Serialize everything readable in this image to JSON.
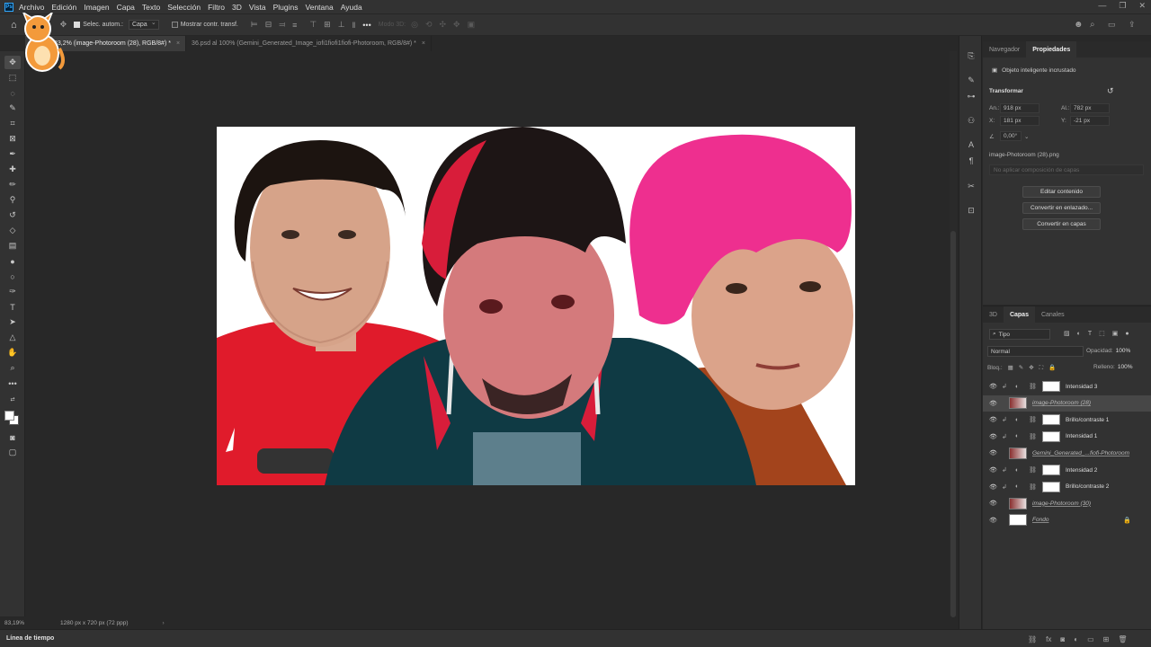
{
  "menubar": {
    "logo": "Ps",
    "items": [
      "Archivo",
      "Edición",
      "Imagen",
      "Capa",
      "Texto",
      "Selección",
      "Filtro",
      "3D",
      "Vista",
      "Plugins",
      "Ventana",
      "Ayuda"
    ]
  },
  "options": {
    "auto_select_label": "Selec. autom.:",
    "auto_select_target": "Capa",
    "show_transform_label": "Mostrar contr. transf.",
    "mode_3d_label": "Modo 3D:"
  },
  "tabs": [
    {
      "label": "83,2% (image-Photoroom (28), RGB/8#) *",
      "active": true
    },
    {
      "label": "36.psd al 100% (Gemini_Generated_Image_iofi1fiofi1fiofi-Photoroom, RGB/8#) *",
      "active": false
    }
  ],
  "status": {
    "zoom": "83,19%",
    "doc_info": "1280 px x 720 px (72 ppp)"
  },
  "timeline": {
    "label": "Línea de tiempo"
  },
  "properties": {
    "tabs": [
      "Navegador",
      "Propiedades"
    ],
    "active_tab": "Propiedades",
    "layer_type": "Objeto inteligente incrustado",
    "transform_title": "Transformar",
    "width_label": "An.:",
    "width_value": "918 px",
    "height_label": "Al.:",
    "height_value": "782 px",
    "x_label": "X:",
    "x_value": "181 px",
    "y_label": "Y:",
    "y_value": "-21 px",
    "angle_value": "0,00°",
    "source_file": "image-Photoroom (28).png",
    "comp_placeholder": "No aplicar composición de capas",
    "buttons": [
      "Editar contenido",
      "Convertir en enlazado...",
      "Convertir en capas"
    ]
  },
  "layers_panel": {
    "tabs": [
      "3D",
      "Capas",
      "Canales"
    ],
    "active_tab": "Capas",
    "filter_kind": "Tipo",
    "blend_mode": "Normal",
    "opacity_label": "Opacidad:",
    "opacity_value": "100%",
    "lock_label": "Bloq.:",
    "fill_label": "Relleno:",
    "fill_value": "100%",
    "layers": [
      {
        "name": "Intensidad 3",
        "kind": "adjustment",
        "selected": false
      },
      {
        "name": "image-Photoroom (28)",
        "kind": "smart",
        "selected": true
      },
      {
        "name": "Brillo/contraste 1",
        "kind": "adjustment",
        "selected": false
      },
      {
        "name": "Intensidad 1",
        "kind": "adjustment",
        "selected": false
      },
      {
        "name": "Gemini_Generated_...fiofi-Photoroom",
        "kind": "smart",
        "selected": false
      },
      {
        "name": "Intensidad 2",
        "kind": "adjustment",
        "selected": false
      },
      {
        "name": "Brillo/contraste 2",
        "kind": "adjustment",
        "selected": false
      },
      {
        "name": "image-Photoroom (30)",
        "kind": "smart",
        "selected": false
      },
      {
        "name": "Fondo",
        "kind": "background",
        "selected": false
      }
    ]
  },
  "colors": {
    "app_bg": "#282828",
    "panel_bg": "#323232",
    "ps_blue": "#31a8ff",
    "hair_red": "#d81d3a",
    "hair_pink": "#ee2f8f",
    "shirt_red": "#e01b2b",
    "jacket_teal": "#0f3a44",
    "shirt_rust": "#a3441c"
  }
}
